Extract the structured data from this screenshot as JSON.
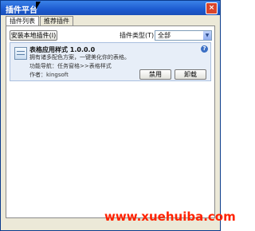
{
  "window": {
    "title": "插件平台",
    "close_glyph": "×"
  },
  "tabs": [
    {
      "label": "插件列表",
      "active": true
    },
    {
      "label": "推荐插件",
      "active": false
    }
  ],
  "toolbar": {
    "install_label": "安装本地插件(I)",
    "type_label": "插件类型(T):",
    "type_value": "全部",
    "dropdown_glyph": "▼"
  },
  "plugins": [
    {
      "title": "表格应用样式 1.0.0.0",
      "description": "拥有诸多配色方案，一键美化你的表格。",
      "nav": "功能导航：任务窗格>>表格样式",
      "author": "作者：kingsoft",
      "disable_label": "禁用",
      "uninstall_label": "卸载",
      "info_glyph": "?"
    }
  ],
  "watermark": "www.xuehuiba.com"
}
